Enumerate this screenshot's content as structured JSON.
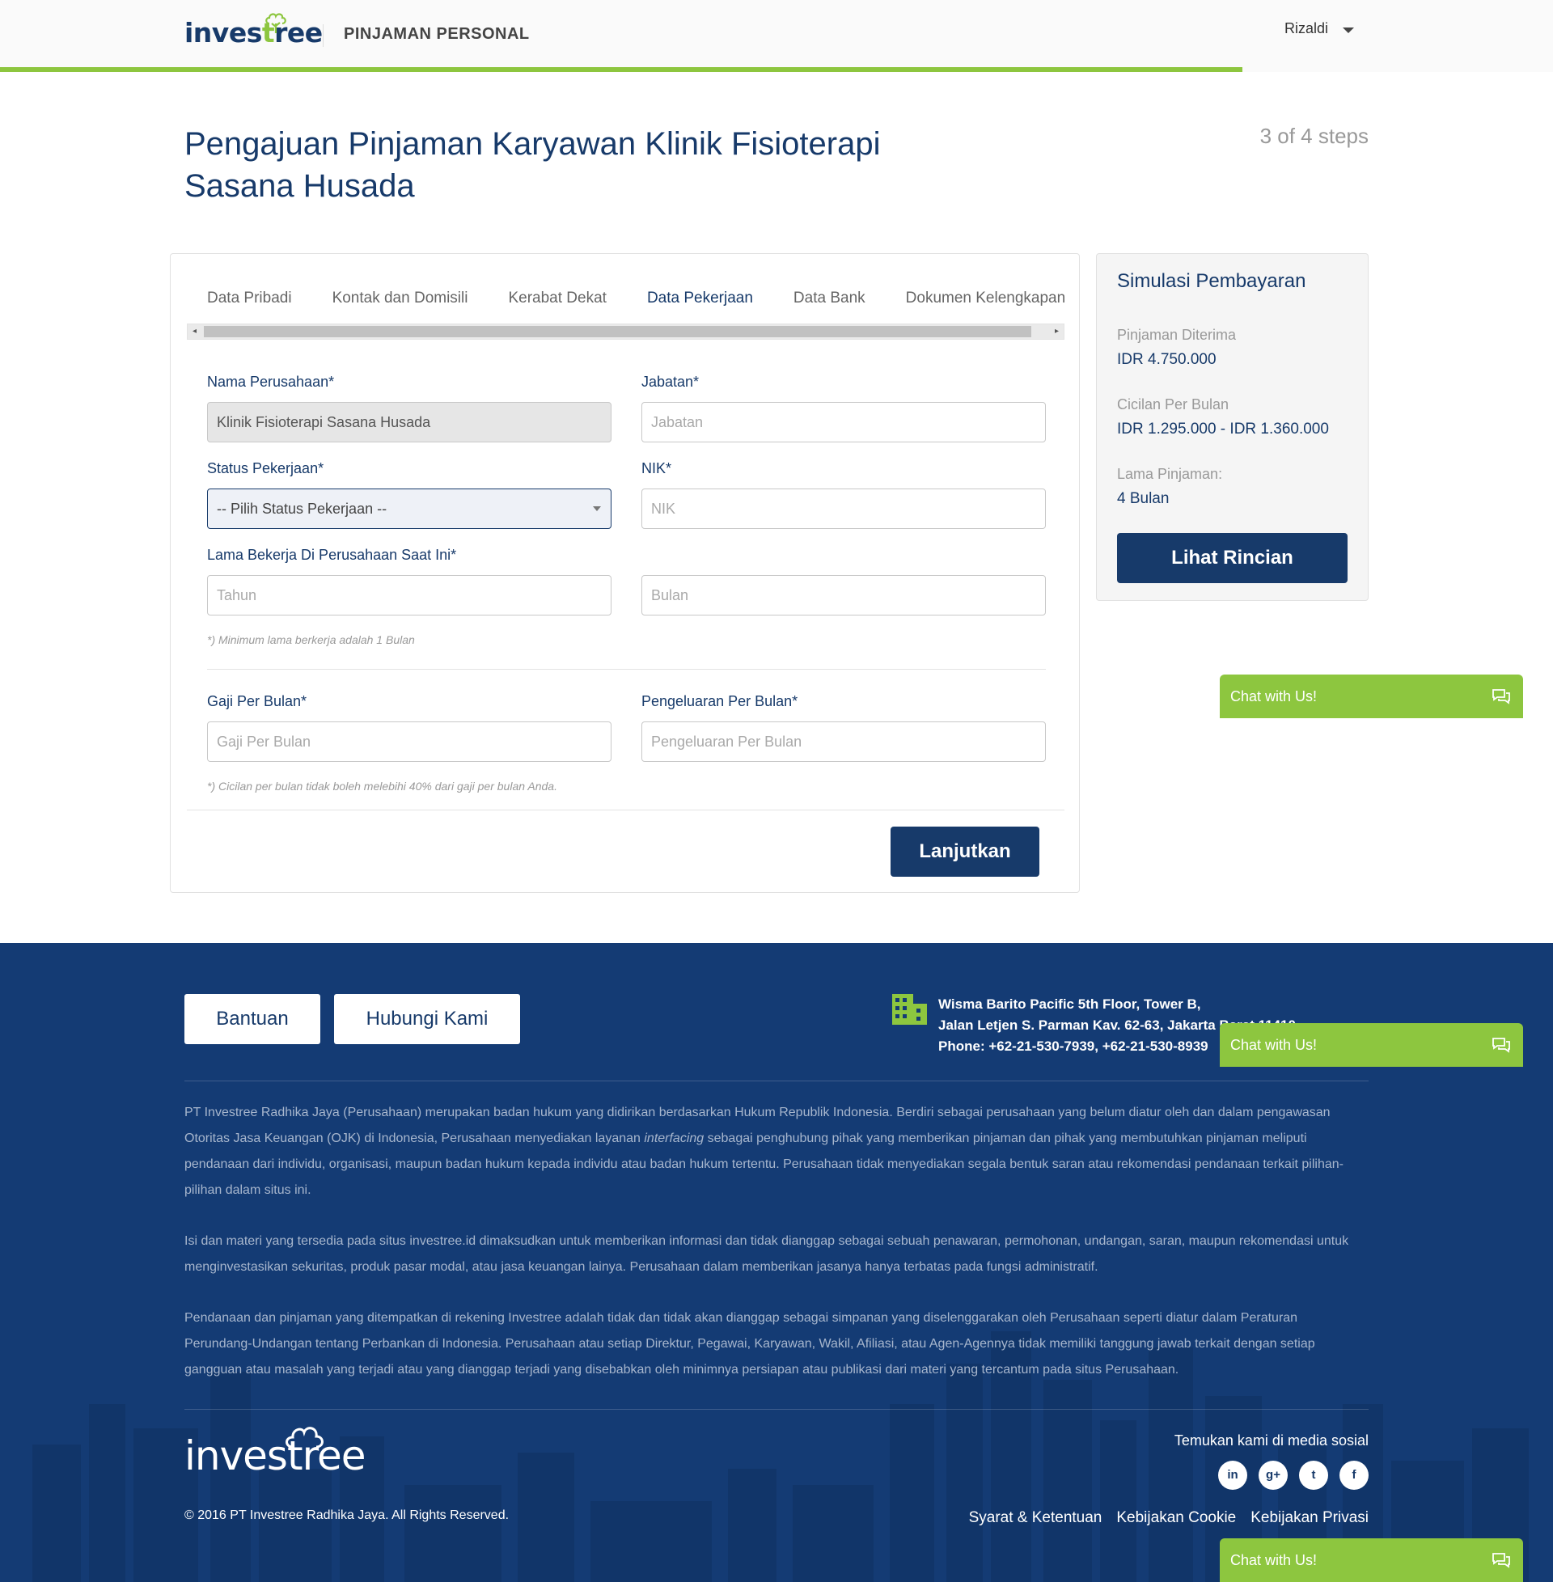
{
  "header": {
    "logo": "investree",
    "product": "PINJAMAN PERSONAL",
    "user": "Rizaldi",
    "progress_fraction": 0.8
  },
  "page": {
    "title_line1": "Pengajuan Pinjaman Karyawan Klinik Fisioterapi",
    "title_line2": "Sasana Husada",
    "steps": "3 of 4 steps"
  },
  "tabs": [
    {
      "label": "Data Pribadi",
      "active": false
    },
    {
      "label": "Kontak dan Domisili",
      "active": false
    },
    {
      "label": "Kerabat Dekat",
      "active": false
    },
    {
      "label": "Data Pekerjaan",
      "active": true
    },
    {
      "label": "Data Bank",
      "active": false
    },
    {
      "label": "Dokumen Kelengkapan",
      "active": false
    }
  ],
  "form": {
    "company_label": "Nama Perusahaan*",
    "company_value": "Klinik Fisioterapi Sasana Husada",
    "position_label": "Jabatan*",
    "position_placeholder": "Jabatan",
    "status_label": "Status Pekerjaan*",
    "status_value": "-- Pilih Status Pekerjaan --",
    "nik_label": "NIK*",
    "nik_placeholder": "NIK",
    "tenure_label": "Lama Bekerja Di Perusahaan Saat Ini*",
    "years_placeholder": "Tahun",
    "months_placeholder": "Bulan",
    "tenure_hint": "*) Minimum lama berkerja adalah 1 Bulan",
    "salary_label": "Gaji Per Bulan*",
    "salary_placeholder": "Gaji Per Bulan",
    "expense_label": "Pengeluaran Per Bulan*",
    "expense_placeholder": "Pengeluaran Per Bulan",
    "salary_hint": "*) Cicilan per bulan tidak boleh melebihi 40% dari gaji per bulan Anda.",
    "submit": "Lanjutkan"
  },
  "simulation": {
    "title": "Simulasi Pembayaran",
    "loan_label": "Pinjaman Diterima",
    "loan_value": "IDR 4.750.000",
    "installment_label": "Cicilan Per Bulan",
    "installment_value": "IDR 1.295.000 - IDR 1.360.000",
    "duration_label": "Lama Pinjaman:",
    "duration_value": "4 Bulan",
    "details_button": "Lihat Rincian"
  },
  "chat": {
    "label": "Chat with Us!"
  },
  "footer": {
    "help_button": "Bantuan",
    "contact_button": "Hubungi Kami",
    "address_line1": "Wisma Barito Pacific 5th Floor, Tower B,",
    "address_line2": "Jalan Letjen S. Parman Kav. 62-63, Jakarta Barat 11410",
    "address_phone": "Phone: +62-21-530-7939, +62-21-530-8939",
    "para1_a": "PT Investree Radhika Jaya (Perusahaan) merupakan badan hukum yang didirikan berdasarkan Hukum Republik Indonesia. Berdiri sebagai perusahaan yang belum diatur oleh dan dalam pengawasan Otoritas Jasa Keuangan (OJK) di Indonesia, Perusahaan menyediakan layanan ",
    "para1_em": "interfacing",
    "para1_b": " sebagai penghubung pihak yang memberikan pinjaman dan pihak yang membutuhkan pinjaman meliputi pendanaan dari individu, organisasi, maupun badan hukum kepada individu atau badan hukum tertentu. Perusahaan tidak menyediakan segala bentuk saran atau rekomendasi pendanaan terkait pilihan-pilihan dalam situs ini.",
    "para2": "Isi dan materi yang tersedia pada situs investree.id dimaksudkan untuk memberikan informasi dan tidak dianggap sebagai sebuah penawaran, permohonan, undangan, saran, maupun rekomendasi untuk menginvestasikan sekuritas, produk pasar modal, atau jasa keuangan lainya. Perusahaan dalam memberikan jasanya hanya terbatas pada fungsi administratif.",
    "para3": "Pendanaan dan pinjaman yang ditempatkan di rekening Investree adalah tidak dan tidak akan dianggap sebagai simpanan yang diselenggarakan oleh Perusahaan seperti diatur dalam Peraturan Perundang-Undangan tentang Perbankan di Indonesia. Perusahaan atau setiap Direktur, Pegawai, Karyawan, Wakil, Afiliasi, atau Agen-Agennya tidak memiliki tanggung jawab terkait dengan setiap gangguan atau masalah yang terjadi atau yang dianggap terjadi yang disebabkan oleh minimnya persiapan atau publikasi dari materi yang tercantum pada situs Perusahaan.",
    "logo": "investree",
    "copyright": "© 2016 PT Investree Radhika Jaya. All Rights Reserved.",
    "social_label": "Temukan kami di media sosial",
    "social": [
      {
        "icon": "linkedin-icon",
        "glyph": "in"
      },
      {
        "icon": "google-plus-icon",
        "glyph": "g+"
      },
      {
        "icon": "twitter-icon",
        "glyph": "t"
      },
      {
        "icon": "facebook-icon",
        "glyph": "f"
      }
    ],
    "links": [
      "Syarat & Ketentuan",
      "Kebijakan Cookie",
      "Kebijakan Privasi"
    ]
  },
  "colors": {
    "brand_navy": "#173a6a",
    "brand_green": "#8dc63f",
    "footer_bg": "#143b74"
  }
}
